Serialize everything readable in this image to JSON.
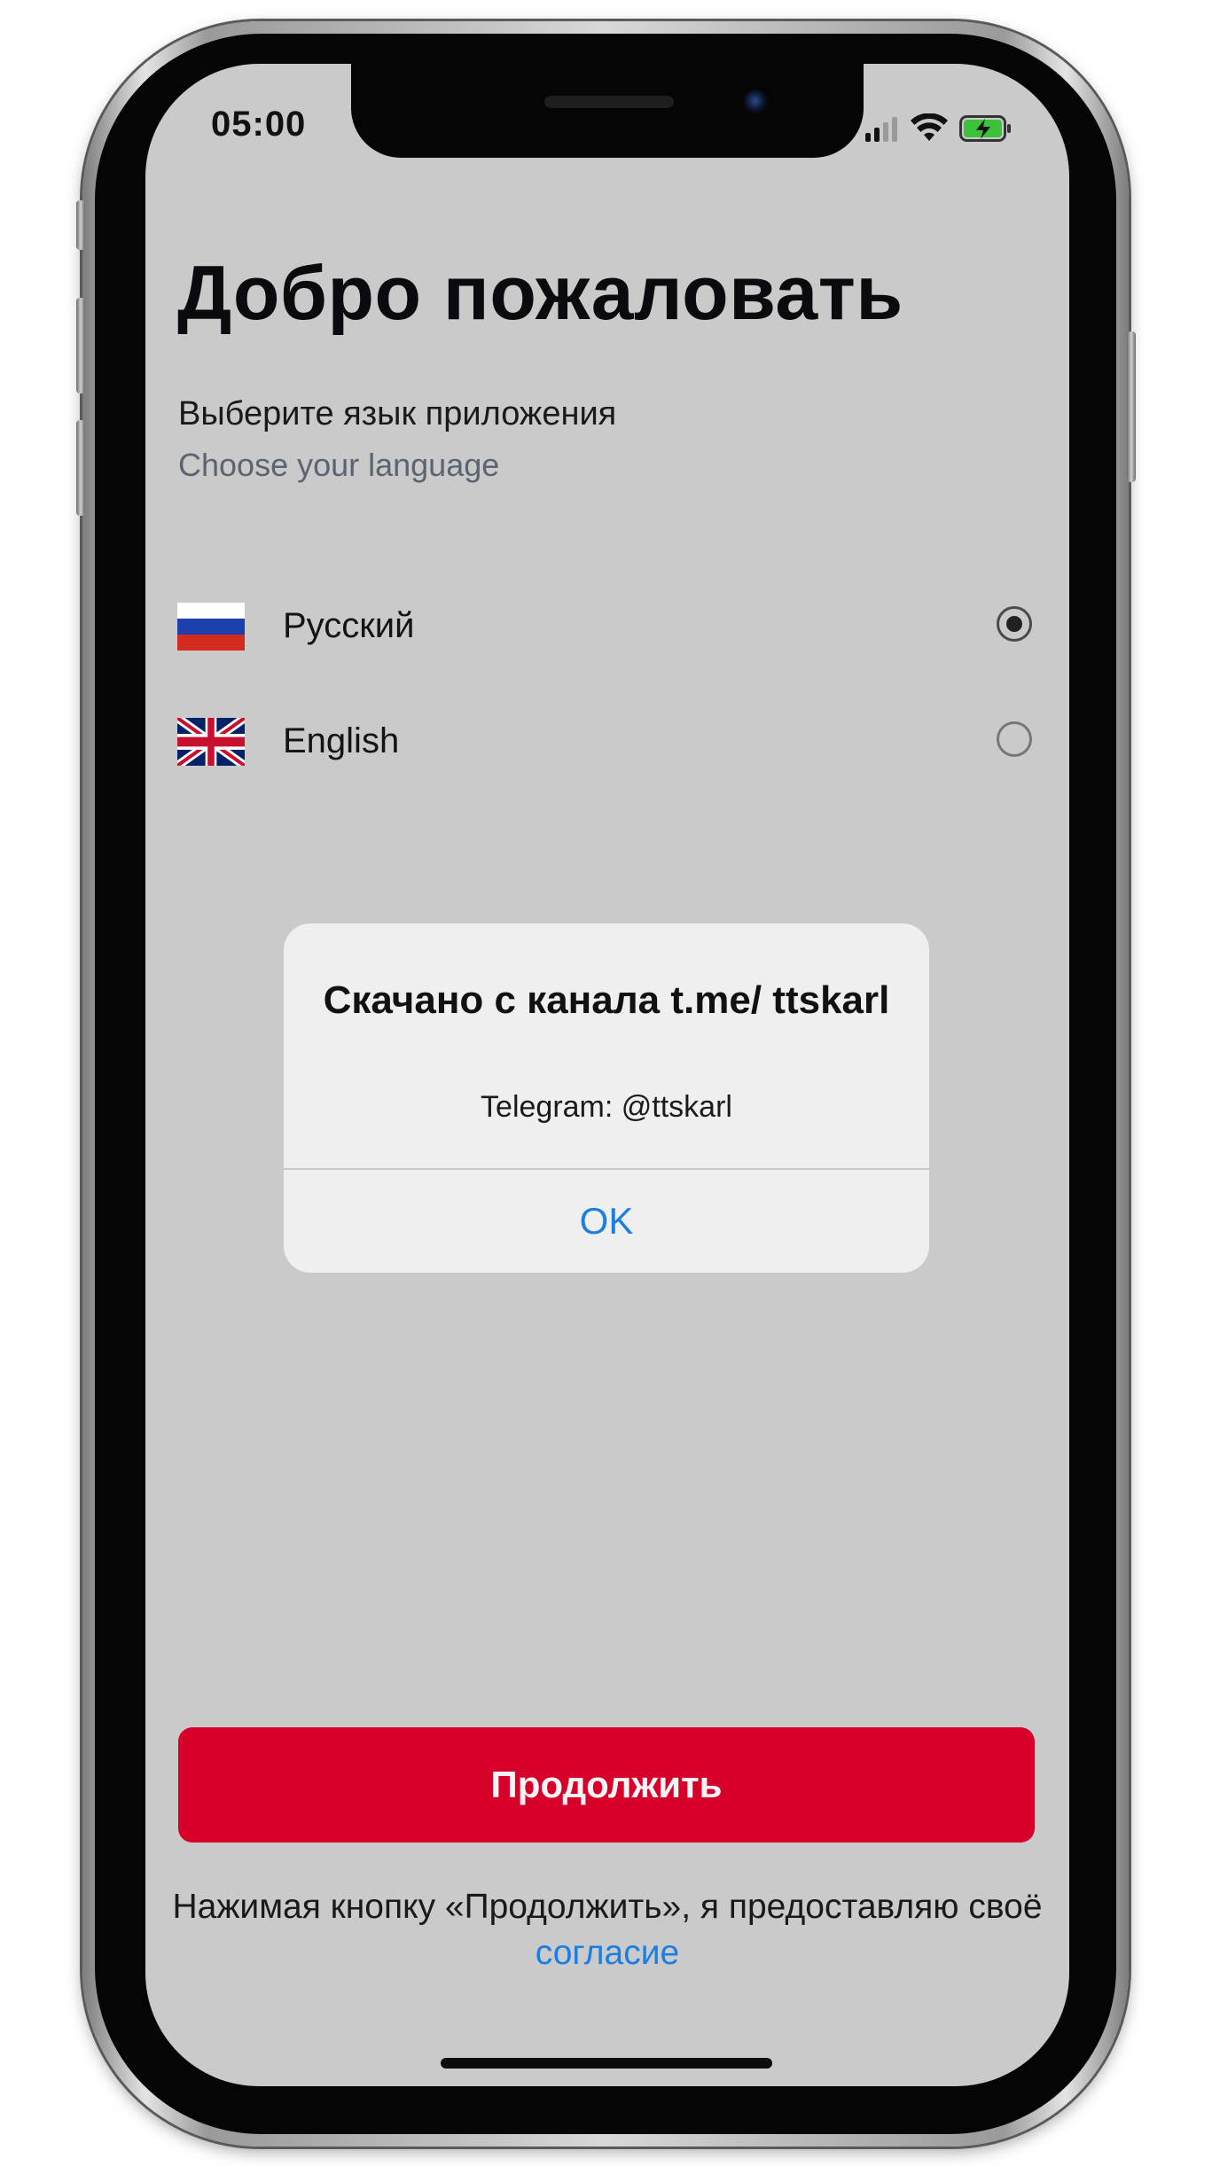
{
  "status_bar": {
    "time": "05:00",
    "icons": [
      "cellular-signal-icon",
      "wifi-icon",
      "battery-charging-icon"
    ],
    "battery_color": "#3cc13b"
  },
  "welcome": {
    "title": "Добро пожаловать",
    "subtitle_ru": "Выберите язык приложения",
    "subtitle_en": "Choose your language"
  },
  "languages": [
    {
      "label": "Русский",
      "flag": "russia-flag-icon",
      "selected": true
    },
    {
      "label": "English",
      "flag": "uk-flag-icon",
      "selected": false
    }
  ],
  "alert": {
    "title": "Скачано с канала t.me/ ttskarl",
    "message": "Telegram: @ttskarl",
    "ok_label": "OK"
  },
  "footer": {
    "continue_label": "Продолжить",
    "consent_text": "Нажимая кнопку «Продолжить», я предоставляю своё",
    "consent_link": "согласие"
  },
  "colors": {
    "accent": "#d6002b",
    "link": "#1a7fe0",
    "background": "#cacaca"
  }
}
